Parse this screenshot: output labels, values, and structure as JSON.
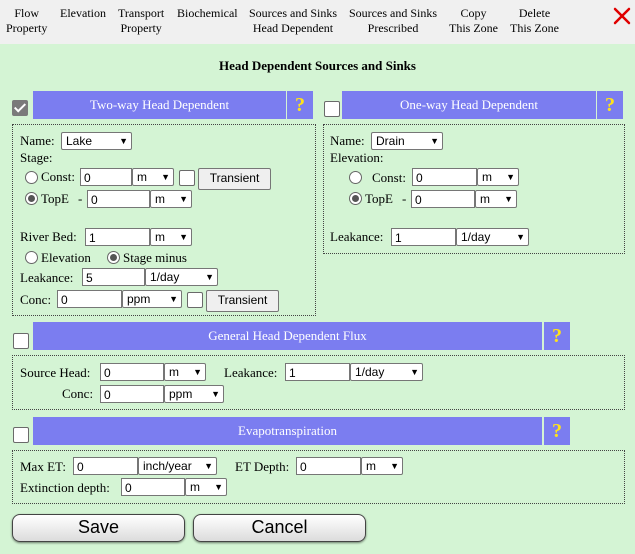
{
  "colors": {
    "header_bg": "#7b7df0",
    "help_mark": "#ffe21a",
    "page_bg": "#d4f4d4",
    "close": "#e00000"
  },
  "nav": [
    {
      "line1": "Flow",
      "line2": "Property"
    },
    {
      "line1": "Elevation",
      "line2": ""
    },
    {
      "line1": "Transport",
      "line2": "Property"
    },
    {
      "line1": "Biochemical",
      "line2": ""
    },
    {
      "line1": "Sources and Sinks",
      "line2": "Head Dependent"
    },
    {
      "line1": "Sources and Sinks",
      "line2": "Prescribed"
    },
    {
      "line1": "Copy",
      "line2": "This Zone"
    },
    {
      "line1": "Delete",
      "line2": "This Zone"
    }
  ],
  "close_icon": "close-x-icon",
  "page_title": "Head Dependent Sources and Sinks",
  "help_mark": "?",
  "two_way": {
    "header": "Two-way Head Dependent",
    "checked": true,
    "name_label": "Name:",
    "name_value": "Lake",
    "stage_label": "Stage:",
    "const_label": "Const:",
    "const_value": "0",
    "const_unit": "m",
    "transient_label": "Transient",
    "tope_label": "TopE",
    "tope_dash": "-",
    "tope_value": "0",
    "tope_unit": "m",
    "riverbed_label": "River Bed:",
    "riverbed_value": "1",
    "riverbed_unit": "m",
    "elevation_label": "Elevation",
    "stage_minus_label": "Stage minus",
    "leakance_label": "Leakance:",
    "leakance_value": "5",
    "leakance_unit": "1/day",
    "conc_label": "Conc:",
    "conc_value": "0",
    "conc_unit": "ppm",
    "conc_transient_label": "Transient"
  },
  "one_way": {
    "header": "One-way Head Dependent",
    "checked": false,
    "name_label": "Name:",
    "name_value": "Drain",
    "elevation_label": "Elevation:",
    "const_label": "Const:",
    "const_value": "0",
    "const_unit": "m",
    "tope_label": "TopE",
    "tope_dash": "-",
    "tope_value": "0",
    "tope_unit": "m",
    "leakance_label": "Leakance:",
    "leakance_value": "1",
    "leakance_unit": "1/day"
  },
  "flux": {
    "header": "General Head Dependent Flux",
    "checked": false,
    "source_head_label": "Source Head:",
    "source_head_value": "0",
    "source_head_unit": "m",
    "leakance_label": "Leakance:",
    "leakance_value": "1",
    "leakance_unit": "1/day",
    "conc_label": "Conc:",
    "conc_value": "0",
    "conc_unit": "ppm"
  },
  "evapo": {
    "header": "Evapotranspiration",
    "checked": false,
    "max_et_label": "Max ET:",
    "max_et_value": "0",
    "max_et_unit": "inch/year",
    "et_depth_label": "ET Depth:",
    "et_depth_value": "0",
    "et_depth_unit": "m",
    "extinction_label": "Extinction depth:",
    "extinction_value": "0",
    "extinction_unit": "m"
  },
  "save_label": "Save",
  "cancel_label": "Cancel"
}
